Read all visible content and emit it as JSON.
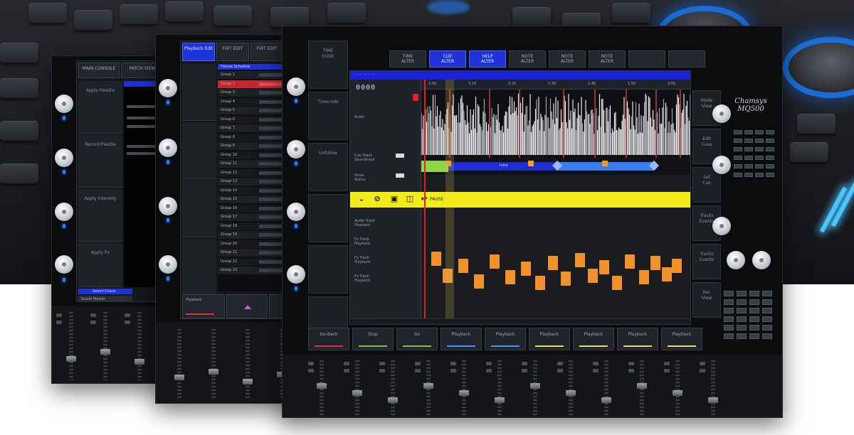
{
  "main": {
    "timeline_clock": "0000",
    "selection_bar_label": "PAUSE",
    "cue_blue_label": "Intro",
    "tabs": [
      {
        "label": "TIME\nALTER",
        "active": false
      },
      {
        "label": "CUE\nALTER",
        "active": true
      },
      {
        "label": "HELP\nALTER",
        "active": true
      },
      {
        "label": "NOTE\nALTER",
        "active": false
      },
      {
        "label": "NOTE\nALTER",
        "active": false
      },
      {
        "label": "NOTE\nALTER",
        "active": false
      },
      {
        "label": "",
        "active": false
      },
      {
        "label": "",
        "active": false
      }
    ],
    "left_softkeys": [
      "TIME\nCODE",
      "Timecode",
      "Unfollow",
      "",
      "",
      ""
    ],
    "right_softkeys": [
      "Mode\nView",
      "Edit\nCues",
      "Set\nCue",
      "Tracks\nEvents",
      "Tracks\nEvents",
      "Rec\nView"
    ],
    "track_labels": [
      "Audio",
      "Cue Stack\nSoundtrack",
      "Show\nStatus",
      "Audio Track\nPlayback",
      "Fx Track\nPlayback",
      "Fx Track\nPlayback",
      "Fx Track\nPlayback"
    ],
    "ruler_labels": [
      "1:00",
      "1:10",
      "1:20",
      "1:30",
      "1:40",
      "1:50",
      "2:00"
    ],
    "bottom_keys": [
      {
        "label": "Go-Back",
        "accent": "#d8343d"
      },
      {
        "label": "Stop",
        "accent": "#7cc43e"
      },
      {
        "label": "Go",
        "accent": "#7cc43e"
      },
      {
        "label": "Playback",
        "accent": "#4a8bff"
      },
      {
        "label": "Playback",
        "accent": "#4a8bff"
      },
      {
        "label": "Playback",
        "accent": "#e6e14a"
      },
      {
        "label": "Playback",
        "accent": "#e6e14a"
      },
      {
        "label": "Playback",
        "accent": "#e6e14a"
      },
      {
        "label": "Playback",
        "accent": "#e6e14a"
      }
    ],
    "logo_text": "Chamsys\nMQ500"
  },
  "mid": {
    "top_tab": "Playback\nEdit",
    "tabs": [
      "FIXT\nEDIT",
      "FIXT\nEDIT"
    ],
    "list_header": "Fixture Schedule",
    "rows": [
      "Group 1",
      "Group 2",
      "Group 3",
      "Group 4",
      "Group 5",
      "Group 6",
      "Group 7",
      "Group 8",
      "Group 9",
      "Group 10",
      "Group 11",
      "Group 12",
      "Group 13",
      "Group 14",
      "Group 15",
      "Group 16",
      "Group 17",
      "Group 18",
      "Group 19",
      "Group 20",
      "Group 21",
      "Group 22",
      "Group 23"
    ],
    "bottom_label": "Playback"
  },
  "left": {
    "tabs": [
      "MAIN\nCONSOLE",
      "PATCH\nVIEW"
    ],
    "softkeys": [
      "Apply\nPalette",
      "Record\nPalette",
      "Apply\nIntensity",
      "Apply\nFx"
    ],
    "blue_label": "Select Chans",
    "bottom_label": "Grand Master"
  },
  "colors": {
    "accent_blue": "#1f33d6",
    "highlight_yellow": "#f4ec1a",
    "cue_orange": "#f1912b",
    "playhead_red": "#e5202a",
    "cue_green": "#8cd64a"
  }
}
